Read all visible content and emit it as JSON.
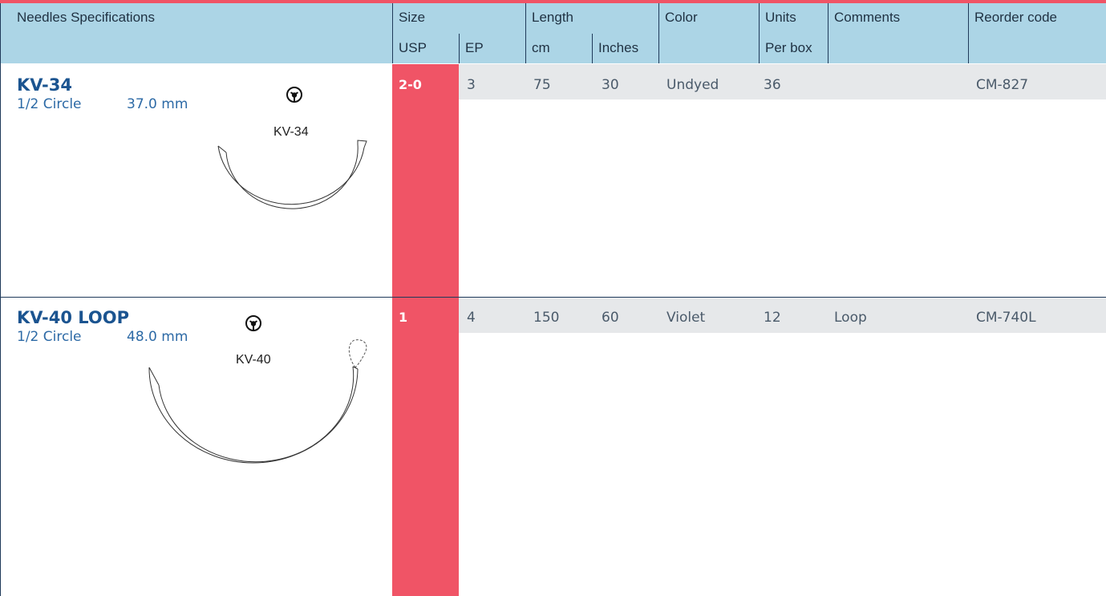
{
  "header": {
    "needles_spec": "Needles Specifications",
    "size": "Size",
    "length": "Length",
    "color": "Color",
    "units": "Units",
    "comments": "Comments",
    "reorder": "Reorder code",
    "usp": "USP",
    "ep": "EP",
    "cm": "cm",
    "inches": "Inches",
    "per_box": "Per box"
  },
  "rows": [
    {
      "name": "KV-34",
      "shape": "1/2 Circle",
      "length_mm": "37.0 mm",
      "diagram_label": "KV-34",
      "usp": "2-0",
      "ep": "3",
      "cm": "75",
      "inches": "30",
      "color": "Undyed",
      "units": "36",
      "comments": "",
      "reorder": "CM-827"
    },
    {
      "name": "KV-40 LOOP",
      "shape": "1/2 Circle",
      "length_mm": "48.0 mm",
      "diagram_label": "KV-40",
      "usp": "1",
      "ep": "4",
      "cm": "150",
      "inches": "60",
      "color": "Violet",
      "units": "12",
      "comments": "Loop",
      "reorder": "CM-740L"
    }
  ],
  "colors": {
    "accent": "#f05466",
    "header_bg": "#acd5e6",
    "row_band": "#e6e8ea",
    "name_blue": "#1b5490"
  },
  "icons": [
    "needle-point-icon",
    "needle-point-icon"
  ]
}
